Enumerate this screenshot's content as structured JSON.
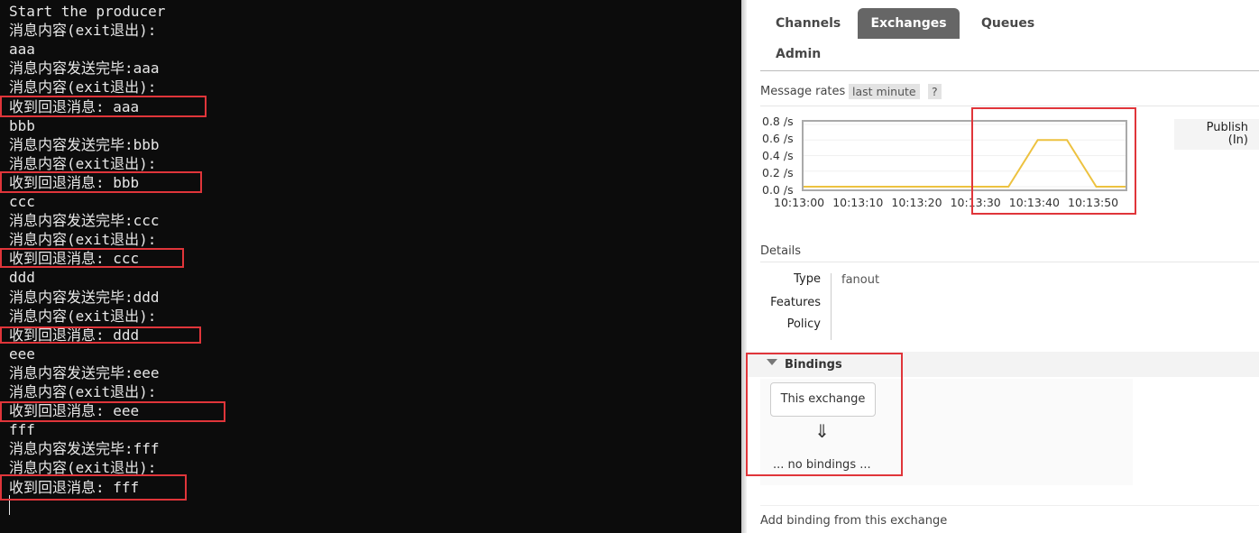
{
  "terminal": {
    "lines": [
      "Start the producer",
      "消息内容(exit退出):",
      "aaa",
      "消息内容发送完毕:aaa",
      "消息内容(exit退出):",
      "收到回退消息: aaa",
      "bbb",
      "消息内容发送完毕:bbb",
      "消息内容(exit退出):",
      "收到回退消息: bbb",
      "ccc",
      "消息内容发送完毕:ccc",
      "消息内容(exit退出):",
      "收到回退消息: ccc",
      "ddd",
      "消息内容发送完毕:ddd",
      "消息内容(exit退出):",
      "收到回退消息: ddd",
      "eee",
      "消息内容发送完毕:eee",
      "消息内容(exit退出):",
      "收到回退消息: eee",
      "fff",
      "消息内容发送完毕:fff",
      "消息内容(exit退出):",
      "收到回退消息: fff"
    ],
    "highlight_color": "#e0353a"
  },
  "nav": {
    "tabs": [
      "Channels",
      "Exchanges",
      "Queues",
      "Admin"
    ],
    "active": "Exchanges"
  },
  "rates": {
    "label": "Message rates",
    "range": "last minute",
    "help": "?"
  },
  "chart_data": {
    "type": "line",
    "x": [
      "10:13:00",
      "10:13:05",
      "10:13:10",
      "10:13:15",
      "10:13:20",
      "10:13:25",
      "10:13:30",
      "10:13:35",
      "10:13:40",
      "10:13:45",
      "10:13:50",
      "10:13:55"
    ],
    "series": [
      {
        "name": "Publish (In)",
        "values": [
          0,
          0,
          0,
          0,
          0,
          0,
          0,
          0,
          0.6,
          0.6,
          0,
          0
        ],
        "color": "#edc240"
      }
    ],
    "x_ticks": [
      "10:13:00",
      "10:13:10",
      "10:13:20",
      "10:13:30",
      "10:13:40",
      "10:13:50"
    ],
    "y_ticks": [
      "0.8 /s",
      "0.6 /s",
      "0.4 /s",
      "0.2 /s",
      "0.0 /s"
    ],
    "ylim": [
      0,
      0.8
    ],
    "legend": "right"
  },
  "legend": {
    "line1": "Publish",
    "line2": "(In)"
  },
  "details": {
    "title": "Details",
    "rows": [
      {
        "key": "Type",
        "value": "fanout"
      },
      {
        "key": "Features",
        "value": ""
      },
      {
        "key": "Policy",
        "value": ""
      }
    ]
  },
  "bindings": {
    "title": "Bindings",
    "this_exchange": "This exchange",
    "arrow": "⇓",
    "empty": "... no bindings ..."
  },
  "add_binding": {
    "title": "Add binding from this exchange"
  }
}
